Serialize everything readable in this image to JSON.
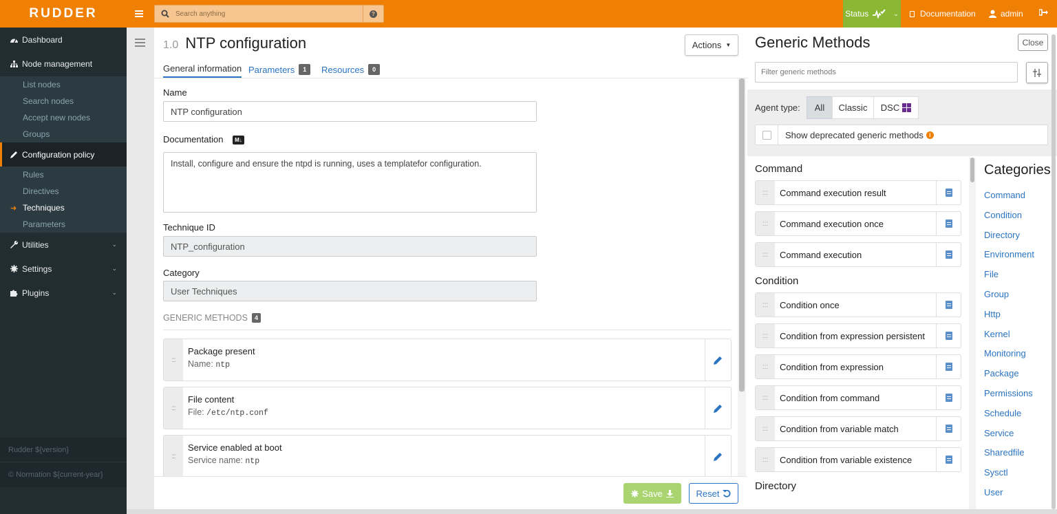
{
  "topbar": {
    "logo": "RUDDER",
    "search_placeholder": "Search anything",
    "status_label": "Status",
    "documentation_label": "Documentation",
    "user_label": "admin"
  },
  "sidebar": {
    "items": [
      {
        "label": "Dashboard",
        "icon": "dashboard-icon"
      },
      {
        "label": "Node management",
        "icon": "sitemap-icon"
      },
      {
        "label": "Configuration policy",
        "icon": "pencil-icon"
      },
      {
        "label": "Utilities",
        "icon": "wrench-icon"
      },
      {
        "label": "Settings",
        "icon": "gear-icon"
      },
      {
        "label": "Plugins",
        "icon": "puzzle-icon"
      }
    ],
    "node_sub": [
      "List nodes",
      "Search nodes",
      "Accept new nodes",
      "Groups"
    ],
    "config_sub": [
      "Rules",
      "Directives",
      "Techniques",
      "Parameters"
    ],
    "footer_version": "Rudder ${version}",
    "footer_copyright": "© Normation ${current-year}"
  },
  "editor": {
    "version": "1.0",
    "title": "NTP configuration",
    "actions_label": "Actions",
    "tabs": [
      {
        "label": "General information"
      },
      {
        "label": "Parameters",
        "count": "1"
      },
      {
        "label": "Resources",
        "count": "0"
      }
    ],
    "name_label": "Name",
    "name_value": "NTP configuration",
    "documentation_label": "Documentation",
    "markdown_badge": "M↓",
    "documentation_value": "Install, configure and ensure the ntpd is running, uses a templatefor configuration.",
    "technique_id_label": "Technique ID",
    "technique_id_value": "NTP_configuration",
    "category_label": "Category",
    "category_value": "User Techniques",
    "generic_methods_label": "GENERIC METHODS",
    "generic_methods_count": "4",
    "methods": [
      {
        "title": "Package present",
        "param_label": "Name:",
        "param_value": "ntp"
      },
      {
        "title": "File content",
        "param_label": "File:",
        "param_value": "/etc/ntp.conf"
      },
      {
        "title": "Service enabled at boot",
        "param_label": "Service name:",
        "param_value": "ntp"
      }
    ],
    "save_label": "Save",
    "reset_label": "Reset"
  },
  "generic_panel": {
    "title": "Generic Methods",
    "close_label": "Close",
    "filter_placeholder": "Filter generic methods",
    "agent_type_label": "Agent type:",
    "agent_types": [
      "All",
      "Classic",
      "DSC"
    ],
    "deprecated_label": "Show deprecated generic methods",
    "groups": [
      {
        "category": "Command",
        "methods": [
          "Command execution result",
          "Command execution once",
          "Command execution"
        ]
      },
      {
        "category": "Condition",
        "methods": [
          "Condition once",
          "Condition from expression persistent",
          "Condition from expression",
          "Condition from command",
          "Condition from variable match",
          "Condition from variable existence"
        ]
      },
      {
        "category": "Directory",
        "methods": []
      }
    ],
    "categories_title": "Categories",
    "categories": [
      "Command",
      "Condition",
      "Directory",
      "Environment",
      "File",
      "Group",
      "Http",
      "Kernel",
      "Monitoring",
      "Package",
      "Permissions",
      "Schedule",
      "Service",
      "Sharedfile",
      "Sysctl",
      "User"
    ]
  },
  "colors": {
    "brand_orange": "#f08004",
    "status_green": "#8ab834",
    "sidebar_bg": "#222d32",
    "link_blue": "#2a74c2"
  }
}
